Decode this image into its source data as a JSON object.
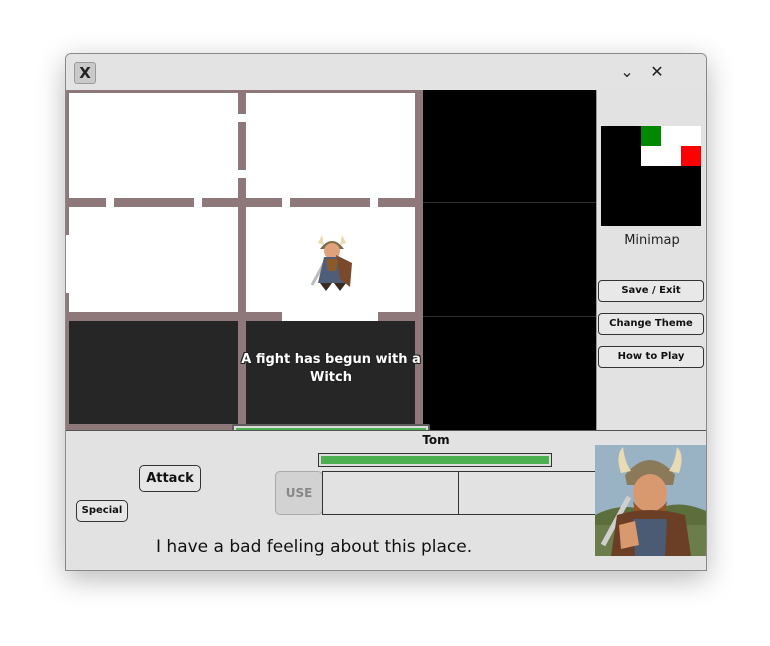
{
  "window": {
    "app_icon": "X",
    "minimize_icon": "⌄",
    "close_icon": "✕"
  },
  "game": {
    "fight_message": "A fight has begun with a Witch",
    "enemy_health_fraction": 1.0,
    "hero_sprite": "viking-warrior-sprite"
  },
  "sidebar": {
    "minimap_label": "Minimap",
    "buttons": [
      "Save / Exit",
      "Change Theme",
      "How to Play"
    ]
  },
  "bottom": {
    "attack_label": "Attack",
    "special_label": "Special",
    "use_label": "USE",
    "player_name": "Tom",
    "player_health_fraction": 1.0,
    "dialogue": "I have a bad feeling about this place.",
    "portrait": "viking-warrior-portrait"
  },
  "colors": {
    "wall": "#8f7879",
    "health": "#4caf50",
    "minimap_player": "#008800",
    "minimap_exit": "#ff0000"
  }
}
